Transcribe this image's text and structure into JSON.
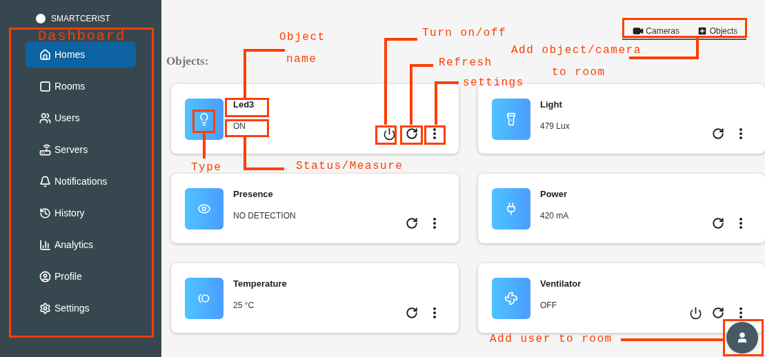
{
  "brand": "SMARTCERIST",
  "sidebar": {
    "items": [
      {
        "label": "Homes",
        "selected": true
      },
      {
        "label": "Rooms",
        "selected": false
      },
      {
        "label": "Users",
        "selected": false
      },
      {
        "label": "Servers",
        "selected": false
      },
      {
        "label": "Notifications",
        "selected": false
      },
      {
        "label": "History",
        "selected": false
      },
      {
        "label": "Analytics",
        "selected": false
      },
      {
        "label": "Profile",
        "selected": false
      },
      {
        "label": "Settings",
        "selected": false
      }
    ]
  },
  "tabs": [
    "Cameras",
    "Objects"
  ],
  "heading": "Objects:",
  "cards": [
    {
      "name": "Led3",
      "value": "ON",
      "kind": "switch"
    },
    {
      "name": "Light",
      "value": "479 Lux",
      "kind": "sensor"
    },
    {
      "name": "Presence",
      "value": "NO DETECTION",
      "kind": "sensor"
    },
    {
      "name": "Power",
      "value": "420 mA",
      "kind": "sensor"
    },
    {
      "name": "Temperature",
      "value": "25 °C",
      "kind": "sensor"
    },
    {
      "name": "Ventilator",
      "value": "OFF",
      "kind": "switch"
    }
  ],
  "annotations": [
    {
      "text": "Dashboard"
    },
    {
      "text": "Object"
    },
    {
      "text": "name"
    },
    {
      "text": "Turn on/off"
    },
    {
      "text": "Refresh"
    },
    {
      "text": "settings"
    },
    {
      "text": "Add object/camera"
    },
    {
      "text": "to room"
    },
    {
      "text": "Type"
    },
    {
      "text": "Status/Measure"
    },
    {
      "text": "Add user to room"
    }
  ]
}
